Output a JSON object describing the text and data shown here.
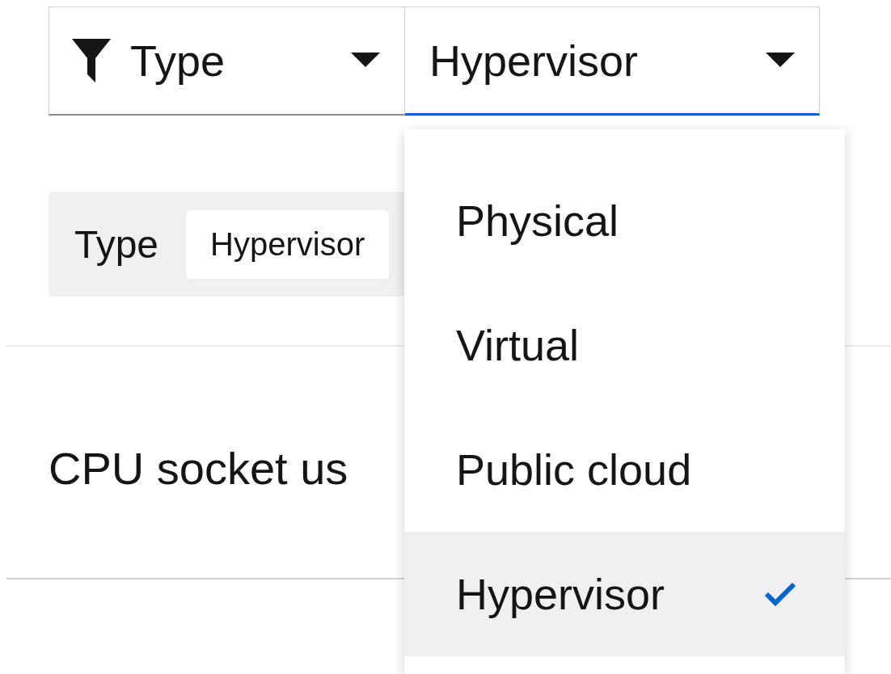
{
  "toolbar": {
    "filter_type": {
      "label": "Type"
    },
    "type_select": {
      "value": "Hypervisor",
      "expanded": true
    }
  },
  "chips": {
    "category": "Type",
    "chips": [
      "Hypervisor"
    ]
  },
  "heading": "CPU socket us",
  "menu": {
    "items": [
      {
        "label": "Physical",
        "selected": false
      },
      {
        "label": "Virtual",
        "selected": false
      },
      {
        "label": "Public cloud",
        "selected": false
      },
      {
        "label": "Hypervisor",
        "selected": true
      }
    ]
  }
}
